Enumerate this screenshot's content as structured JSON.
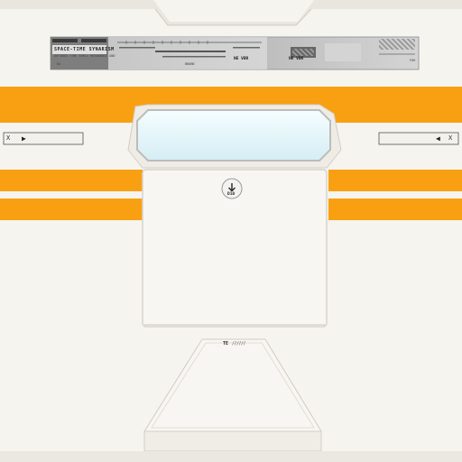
{
  "colors": {
    "panel": "#f6f4ef",
    "panel_shadow": "#d9d6cf",
    "accent_orange": "#f8a012",
    "screen_glass": "#e6f5f8",
    "screen_frame": "#cfcfcf",
    "plate_dark": "#3a3a3a",
    "plate_light": "#c9c9c9"
  },
  "header_plate": {
    "title": "SPACE-TIME SYNARISM",
    "subtitle": "DEFINED TIME SHELL RESONANCE AND",
    "left_code": "B4",
    "middle_code": "BB8BB",
    "readout_a": "NE VBR",
    "readout_b": "NE VBR",
    "corner_code": "FUR"
  },
  "side_ports": {
    "left_label": "X",
    "left_arrow": "▶",
    "right_label": "X",
    "right_arrow": "◀"
  },
  "center_module": {
    "mode_icon": "down-arrow-icon",
    "mode_label": "D10"
  },
  "lower_ramp": {
    "label": "TE",
    "hatch": "//////"
  }
}
